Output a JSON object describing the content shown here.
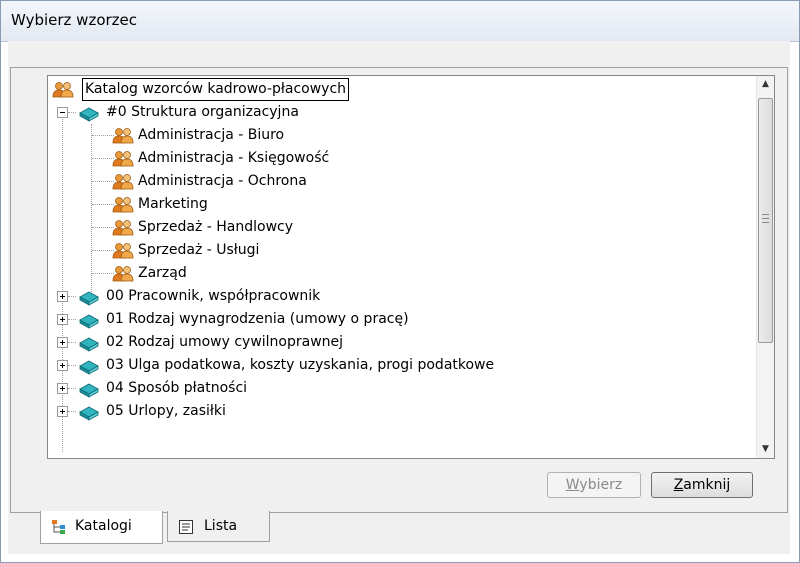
{
  "window": {
    "title": "Wybierz wzorzec"
  },
  "tree": {
    "root": "Katalog wzorców kadrowo-płacowych",
    "expanded_group": "#0 Struktura organizacyjna",
    "children": [
      "Administracja - Biuro",
      "Administracja - Księgowość",
      "Administracja - Ochrona",
      "Marketing",
      "Sprzedaż - Handlowcy",
      "Sprzedaż - Usługi",
      "Zarząd"
    ],
    "collapsed_groups": [
      "00 Pracownik, współpracownik",
      "01 Rodzaj wynagrodzenia (umowy o pracę)",
      "02 Rodzaj umowy cywilnoprawnej",
      "03 Ulga podatkowa, koszty uzyskania, progi podatkowe",
      "04 Sposób płatności",
      "05 Urlopy, zasiłki"
    ]
  },
  "buttons": {
    "select": {
      "prefix": "",
      "accel": "W",
      "rest": "ybierz",
      "enabled": false
    },
    "close": {
      "prefix": "",
      "accel": "Z",
      "rest": "amknij",
      "enabled": true
    }
  },
  "tabs": [
    {
      "label": "Katalogi",
      "icon": "hierarchy-icon",
      "active": true
    },
    {
      "label": "Lista",
      "icon": "list-icon",
      "active": false
    }
  ],
  "colors": {
    "title_bg": "#e3e9f2",
    "dialog_bg": "#f0f0f0",
    "tree_bg": "#ffffff",
    "book_icon": "#1b8f9a",
    "people_icon": "#e07a1f"
  }
}
